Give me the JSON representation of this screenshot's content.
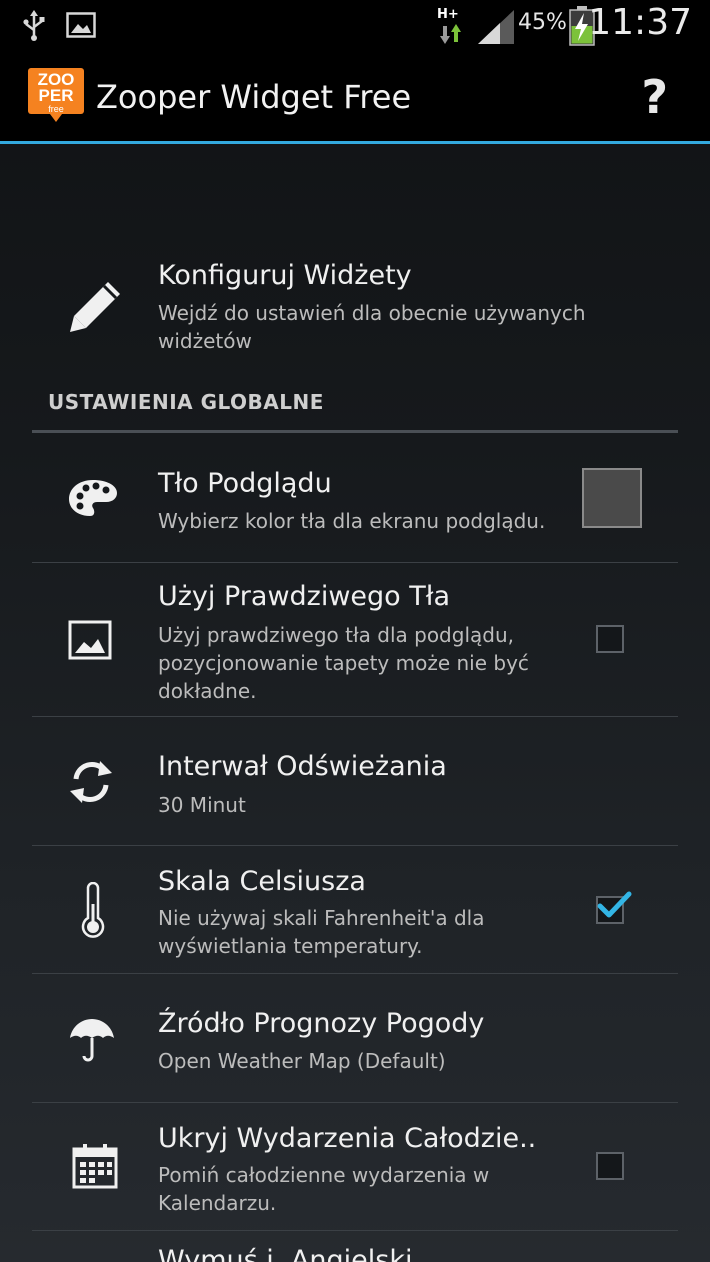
{
  "status_bar": {
    "network_type": "H+",
    "battery_percent": "45%",
    "time": "11:37",
    "icons": [
      "usb-icon",
      "image-icon",
      "network-arrows-icon",
      "signal-icon",
      "battery-charging-icon"
    ]
  },
  "action_bar": {
    "logo_lines": [
      "ZOO",
      "PER",
      "free"
    ],
    "title": "Zooper Widget Free",
    "help_label": "?"
  },
  "configure": {
    "title": "Konfiguruj Widżety",
    "subtitle": "Wejdź do ustawień dla obecnie używanych widżetów"
  },
  "section": {
    "header": "USTAWIENIA GLOBALNE"
  },
  "settings": {
    "preview_bg": {
      "title": "Tło Podglądu",
      "subtitle": "Wybierz kolor tła dla ekranu podglądu.",
      "swatch_color": "#4a4a4a"
    },
    "real_bg": {
      "title": "Użyj Prawdziwego Tła",
      "subtitle": "Użyj prawdziwego tła dla podglądu, pozycjonowanie tapety może nie być dokładne.",
      "checked": false
    },
    "refresh": {
      "title": "Interwał Odświeżania",
      "subtitle": "30 Minut"
    },
    "celsius": {
      "title": "Skala Celsiusza",
      "subtitle": "Nie używaj skali Fahrenheit'a dla wyświetlania temperatury.",
      "checked": true
    },
    "weather": {
      "title": "Źródło Prognozy Pogody",
      "subtitle": "Open Weather Map (Default)"
    },
    "allday": {
      "title": "Ukryj Wydarzenia Całodzie..",
      "subtitle": "Pomiń całodzienne wydarzenia w Kalendarzu.",
      "checked": false
    },
    "partial": {
      "title": "Wymuś j. Angielski"
    }
  },
  "colors": {
    "accent": "#33a9de",
    "check": "#33b5e5"
  }
}
